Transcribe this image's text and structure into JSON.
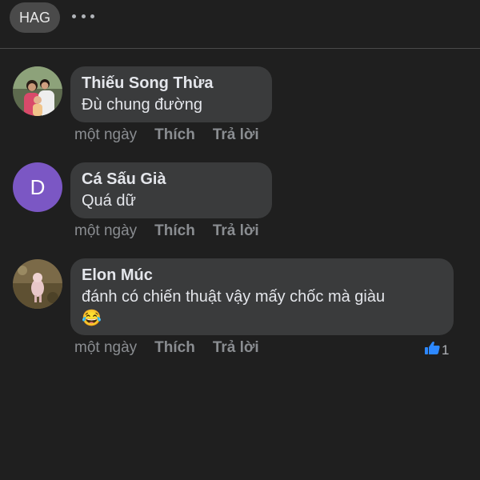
{
  "header": {
    "tag_label": "HAG",
    "more_icon": "more-horizontal-icon"
  },
  "comments": [
    {
      "author": "Thiếu Song Thừa",
      "text": "Đù chung đường",
      "time": "một ngày",
      "like_label": "Thích",
      "reply_label": "Trả lời",
      "avatar": "photo"
    },
    {
      "author": "Cá Sấu Già",
      "text": "Quá dữ",
      "time": "một ngày",
      "like_label": "Thích",
      "reply_label": "Trả lời",
      "avatar_letter": "D",
      "avatar_color": "#7b57c4"
    },
    {
      "author": "Elon Múc",
      "text": "đánh có chiến thuật vậy mấy chốc mà giàu",
      "emoji": "😂",
      "time": "một ngày",
      "like_label": "Thích",
      "reply_label": "Trả lời",
      "reaction_count": "1",
      "reaction_icon": "thumbs-up-icon",
      "avatar": "photo"
    }
  ],
  "colors": {
    "background": "#1f1f1f",
    "bubble": "#3a3b3c",
    "like_blue": "#2d88ff"
  }
}
